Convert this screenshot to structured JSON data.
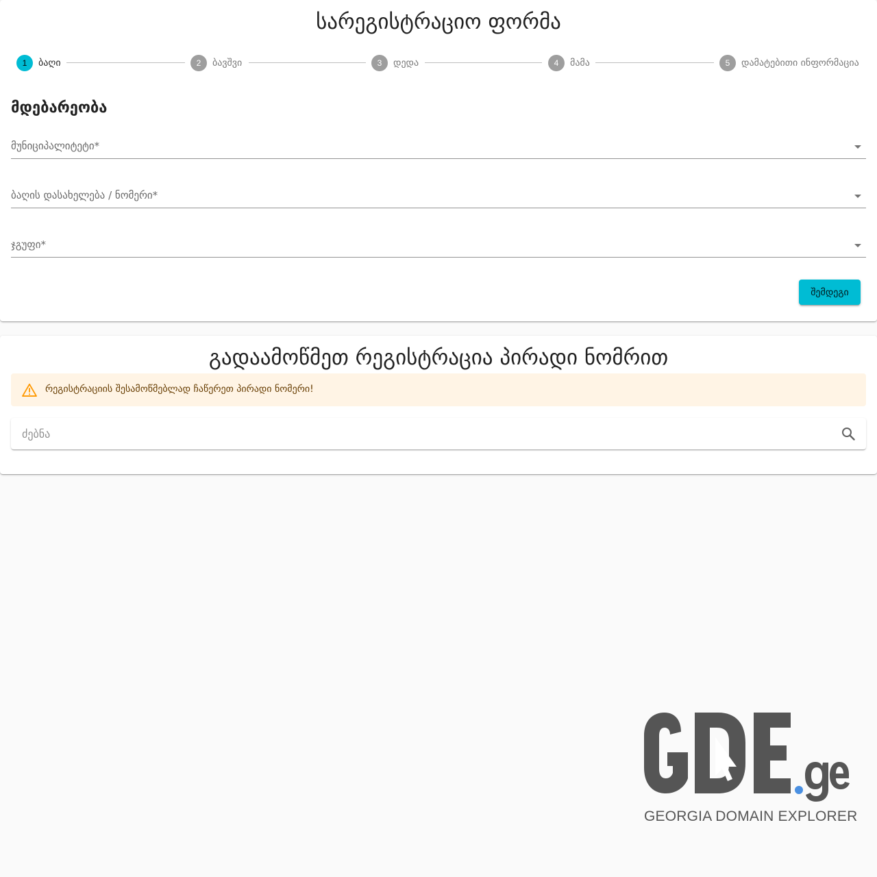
{
  "registration": {
    "title": "სარეგისტრაციო ფორმა",
    "steps": [
      {
        "number": "1",
        "label": "ბაღი",
        "active": true
      },
      {
        "number": "2",
        "label": "ბავშვი",
        "active": false
      },
      {
        "number": "3",
        "label": "დედა",
        "active": false
      },
      {
        "number": "4",
        "label": "მამა",
        "active": false
      },
      {
        "number": "5",
        "label": "დამატებითი ინფორმაცია",
        "active": false
      }
    ],
    "section_title": "მდებარეობა",
    "fields": {
      "municipality": "მუნიციპალიტეტი*",
      "kindergarten": "ბაღის დასახელება / ნომერი*",
      "group": "ჯგუფი*"
    },
    "next_label": "შემდეგი"
  },
  "check": {
    "title": "გადაამოწმეთ რეგისტრაცია პირადი ნომრით",
    "alert_text": "რეგისტრაციის შესამოწმებლად ჩაწერეთ პირადი ნომერი!",
    "search_placeholder": "ძებნა"
  },
  "logo": {
    "text": "GDE.ge",
    "tagline": "GEORGIA DOMAIN EXPLORER"
  },
  "colors": {
    "accent": "#00bcd4",
    "alert_bg": "#fff4e5",
    "alert_icon": "#ff9800",
    "logo_gray": "#555555",
    "logo_dot": "#4a90e2"
  }
}
